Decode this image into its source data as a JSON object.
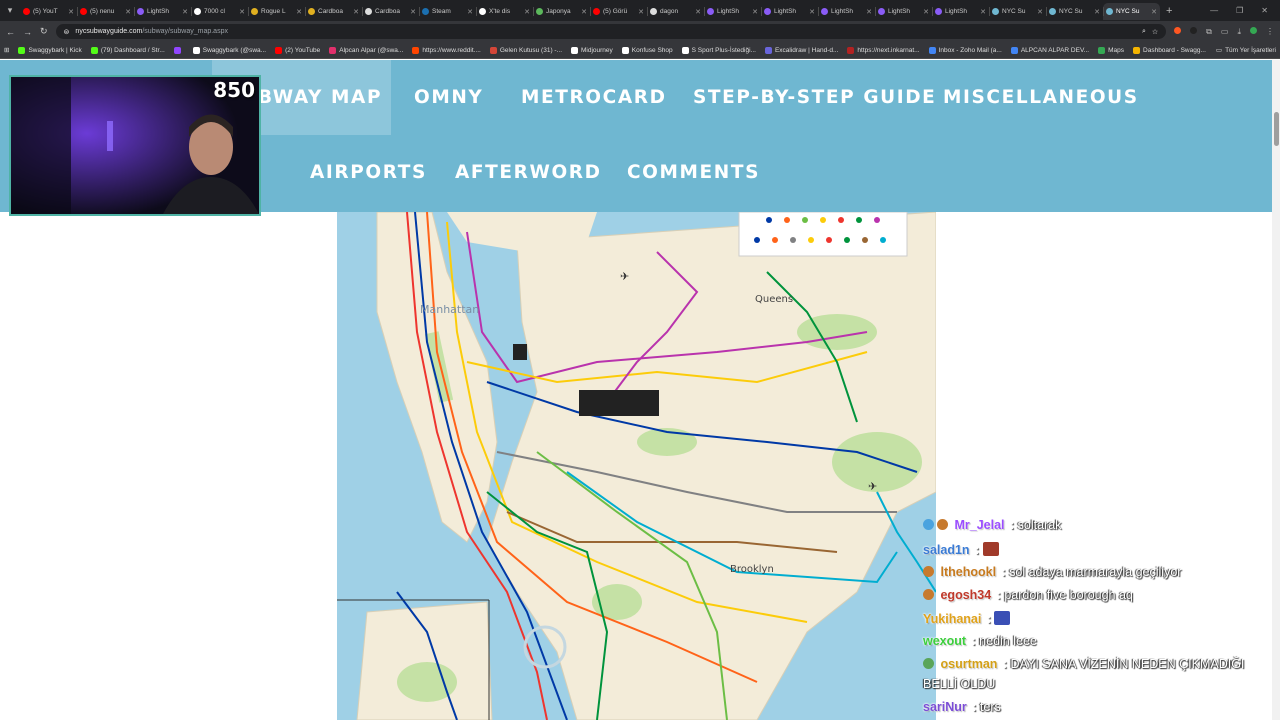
{
  "browser": {
    "tabs": [
      {
        "label": "(5) YouT",
        "color": "#ff0000"
      },
      {
        "label": "(5) nenu",
        "color": "#ff0000"
      },
      {
        "label": "LightSh",
        "color": "#8a5cf6"
      },
      {
        "label": "7000 cl",
        "color": "#ffffff"
      },
      {
        "label": "Rogue L",
        "color": "#e0b020"
      },
      {
        "label": "Cardboa",
        "color": "#e0b020"
      },
      {
        "label": "Cardboa",
        "color": "#dddddd"
      },
      {
        "label": "Steam",
        "color": "#1b6fb0"
      },
      {
        "label": "X'te dis",
        "color": "#ffffff"
      },
      {
        "label": "Japonya",
        "color": "#5cb85c"
      },
      {
        "label": "(5) Görü",
        "color": "#ff0000"
      },
      {
        "label": "dagon",
        "color": "#dddddd"
      },
      {
        "label": "LightSh",
        "color": "#8a5cf6"
      },
      {
        "label": "LightSh",
        "color": "#8a5cf6"
      },
      {
        "label": "LightSh",
        "color": "#8a5cf6"
      },
      {
        "label": "LightSh",
        "color": "#8a5cf6"
      },
      {
        "label": "LightSh",
        "color": "#8a5cf6"
      },
      {
        "label": "NYC Su",
        "color": "#6fb7d1"
      },
      {
        "label": "NYC Su",
        "color": "#6fb7d1"
      },
      {
        "label": "NYC Su",
        "color": "#6fb7d1",
        "active": true
      }
    ],
    "url_host": "nycsubwayguide.com",
    "url_path": "/subway/subway_map.aspx",
    "bookmarks": [
      {
        "label": "Swaggybark | Kick",
        "color": "#53fc18"
      },
      {
        "label": "(79) Dashboard / Str...",
        "color": "#53fc18"
      },
      {
        "label": "",
        "color": "#9146ff"
      },
      {
        "label": "Swaggybark (@swa...",
        "color": "#ffffff"
      },
      {
        "label": "(2) YouTube",
        "color": "#ff0000"
      },
      {
        "label": "Alpcan Alpar (@swa...",
        "color": "#e1306c"
      },
      {
        "label": "https://www.reddit....",
        "color": "#ff4500"
      },
      {
        "label": "Gelen Kutusu (31) -...",
        "color": "#d44638"
      },
      {
        "label": "Midjourney",
        "color": "#ffffff"
      },
      {
        "label": "Konfuse Shop",
        "color": "#ffffff"
      },
      {
        "label": "S Sport Plus-İstediği...",
        "color": "#ffffff"
      },
      {
        "label": "Excalidraw | Hand-d...",
        "color": "#6965db"
      },
      {
        "label": "https://next.inkarnat...",
        "color": "#b22222"
      },
      {
        "label": "Inbox - Zoho Mail (a...",
        "color": "#4285f4"
      },
      {
        "label": "ALPCAN ALPAR DEV...",
        "color": "#4285f4"
      },
      {
        "label": "Maps",
        "color": "#34a853"
      },
      {
        "label": "Dashboard - Swagg...",
        "color": "#f4b400"
      }
    ],
    "all_bookmarks": "Tüm Yer İşaretleri"
  },
  "site_nav": {
    "items": [
      {
        "label": "BWAY MAP",
        "active": true
      },
      {
        "label": "OMNY"
      },
      {
        "label": "METROCARD"
      },
      {
        "label": "STEP-BY-STEP GUIDE"
      },
      {
        "label": "MISCELLANEOUS"
      },
      {
        "label": "AIRPORTS"
      },
      {
        "label": "AFTERWORD"
      },
      {
        "label": "COMMENTS"
      }
    ]
  },
  "map": {
    "labels": [
      "Manhattan",
      "Queens",
      "Brooklyn"
    ],
    "colors": {
      "water": "#9fd0e6",
      "land": "#f3ecd9",
      "park": "#c5e1a5"
    }
  },
  "webcam": {
    "counter": "850"
  },
  "chat": [
    {
      "user": "Mr_Jelal",
      "user_color": "#9b4dff",
      "message": "soltarak",
      "badges": [
        "#4aa3df",
        "#c77a2e"
      ]
    },
    {
      "user": "salad1n",
      "user_color": "#3a7bd5",
      "message": "",
      "emote": "#a03a2a"
    },
    {
      "user": "lthehookl",
      "user_color": "#c77a1e",
      "message": "sol adaya marmarayla geçiliyor",
      "badges": [
        "#c77a2e"
      ]
    },
    {
      "user": "egosh34",
      "user_color": "#c0392b",
      "message": "pardon five borough aq",
      "badges": [
        "#c77a2e"
      ]
    },
    {
      "user": "Yukihanai",
      "user_color": "#e0a21a",
      "message": "",
      "emote": "#3a4fb5"
    },
    {
      "user": "wexout",
      "user_color": "#3ccf3c",
      "message": "nedin leee"
    },
    {
      "user": "osurtman",
      "user_color": "#d4a017",
      "message": "DAYI SANA VİZENİN NEDEN ÇIKMADIĞI",
      "message2": "BELLİ OLDU",
      "badges": [
        "#5aa55a"
      ]
    },
    {
      "user": "sariNur",
      "user_color": "#7b4dd6",
      "message": "ters"
    }
  ]
}
